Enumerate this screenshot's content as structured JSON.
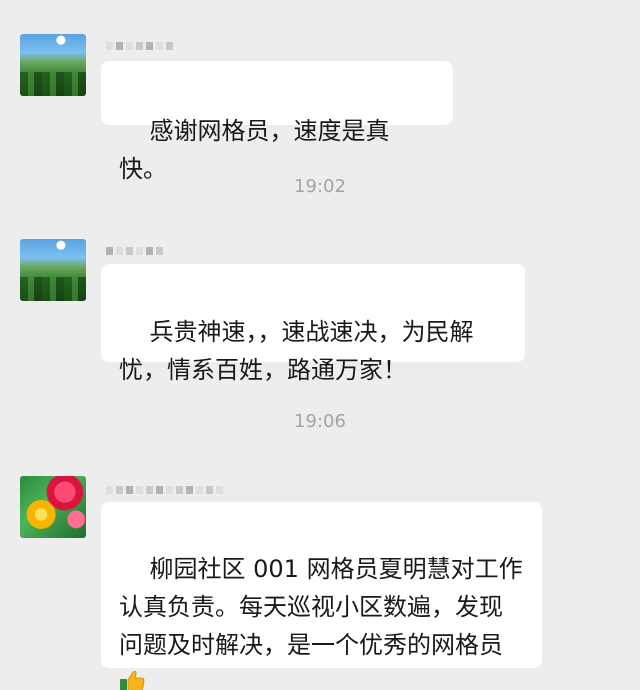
{
  "messages": [
    {
      "sender": "",
      "text": "感谢网格员，速度是真快。"
    },
    {
      "sender": "",
      "text": "兵贵神速，，速战速决，为民解忧，情系百姓，路通万家！"
    },
    {
      "sender": "",
      "text": "柳园社区 001 网格员夏明慧对工作认真负责。每天巡视小区数遍，发现问题及时解决，是一个优秀的网格员"
    }
  ],
  "timestamps": [
    "19:02",
    "19:06"
  ],
  "icons": {
    "avatar_1": "landscape-avatar-icon",
    "avatar_2": "landscape-avatar-icon",
    "avatar_3": "flower-avatar-icon",
    "thumbs_up": "thumbs-up-emoji-icon"
  }
}
